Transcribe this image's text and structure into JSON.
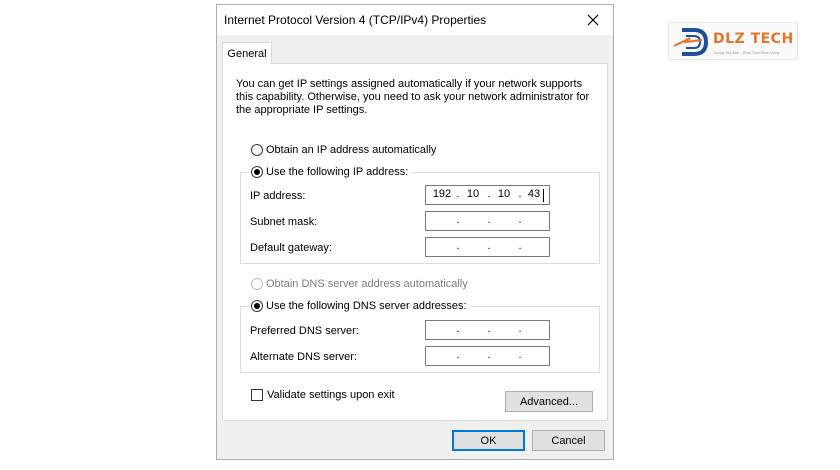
{
  "window": {
    "title": "Internet Protocol Version 4 (TCP/IPv4) Properties"
  },
  "tabs": [
    "General"
  ],
  "description": "You can get IP settings assigned automatically if your network supports this capability. Otherwise, you need to ask your network administrator for the appropriate IP settings.",
  "ip_section": {
    "auto_label": "Obtain an IP address automatically",
    "manual_label": "Use the following IP address:",
    "selected": "manual",
    "fields": [
      {
        "label": "IP address:",
        "octets": [
          "192",
          "10",
          "10",
          "43"
        ]
      },
      {
        "label": "Subnet mask:",
        "octets": [
          "",
          "",
          "",
          ""
        ]
      },
      {
        "label": "Default gateway:",
        "octets": [
          "",
          "",
          "",
          ""
        ]
      }
    ]
  },
  "dns_section": {
    "auto_label": "Obtain DNS server address automatically",
    "auto_disabled": true,
    "manual_label": "Use the following DNS server addresses:",
    "selected": "manual",
    "fields": [
      {
        "label": "Preferred DNS server:",
        "octets": [
          "",
          "",
          "",
          ""
        ]
      },
      {
        "label": "Alternate DNS server:",
        "octets": [
          "",
          "",
          "",
          ""
        ]
      }
    ]
  },
  "validate": {
    "label": "Validate settings upon exit",
    "checked": false
  },
  "buttons": {
    "advanced": "Advanced...",
    "ok": "OK",
    "cancel": "Cancel"
  },
  "logo": {
    "text": "DLZ TECH",
    "tagline": "Tuong Tac Moi - Phat Trien Ben Vung"
  },
  "colors": {
    "accent": "#0078d7",
    "logo_orange": "#e8742c",
    "logo_blue": "#1f4e9c"
  }
}
